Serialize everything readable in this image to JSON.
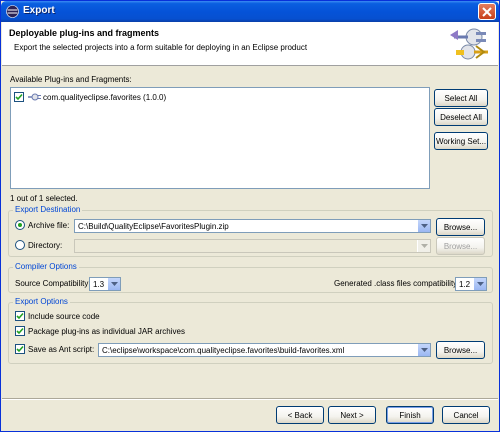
{
  "window": {
    "title": "Export"
  },
  "header": {
    "title": "Deployable plug-ins and fragments",
    "description": "Export the selected projects into a form suitable for deploying in an Eclipse product"
  },
  "available": {
    "label": "Available Plug-ins and Fragments:",
    "items": [
      {
        "label": "com.qualityeclipse.favorites (1.0.0)",
        "checked": true
      }
    ],
    "selection_status": "1 out of 1 selected."
  },
  "side_buttons": {
    "select_all": "Select All",
    "deselect_all": "Deselect All",
    "working_set": "Working Set..."
  },
  "export_destination": {
    "title": "Export Destination",
    "archive_label": "Archive file:",
    "archive_value": "C:\\Build\\QualityEclipse\\FavoritesPlugin.zip",
    "directory_label": "Directory:",
    "directory_value": "",
    "browse": "Browse...",
    "browse2": "Browse..."
  },
  "compiler_options": {
    "title": "Compiler Options",
    "source_label": "Source Compatibility:",
    "source_value": "1.3",
    "generated_label": "Generated .class files compatibility:",
    "generated_value": "1.2"
  },
  "export_options": {
    "title": "Export Options",
    "include_source": "Include source code",
    "package_jar": "Package plug-ins as individual JAR archives",
    "save_ant": "Save as Ant script:",
    "ant_value": "C:\\eclipse\\workspace\\com.qualityeclipse.favorites\\build-favorites.xml",
    "browse": "Browse..."
  },
  "footer": {
    "back": "< Back",
    "next": "Next >",
    "finish": "Finish",
    "cancel": "Cancel"
  },
  "colors": {
    "titlebar": "#0553d8",
    "group_title": "#0046d5",
    "dialog_bg": "#ece9d8"
  }
}
